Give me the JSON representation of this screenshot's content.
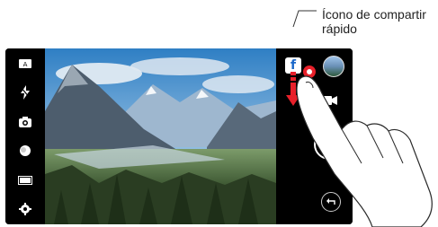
{
  "callout": {
    "label_line1": "Ícono de compartir",
    "label_line2": "rápido"
  },
  "left_controls": [
    {
      "icon": "mode-icon"
    },
    {
      "icon": "flash-off-icon"
    },
    {
      "icon": "switch-camera-icon"
    },
    {
      "icon": "filter-icon"
    },
    {
      "icon": "aspect-ratio-icon"
    },
    {
      "icon": "settings-gear-icon"
    }
  ],
  "share": {
    "icon_glyph": "f"
  },
  "colors": {
    "accent": "#e8202a",
    "facebook_blue": "#1a67c9",
    "panel_bg": "#000000"
  }
}
